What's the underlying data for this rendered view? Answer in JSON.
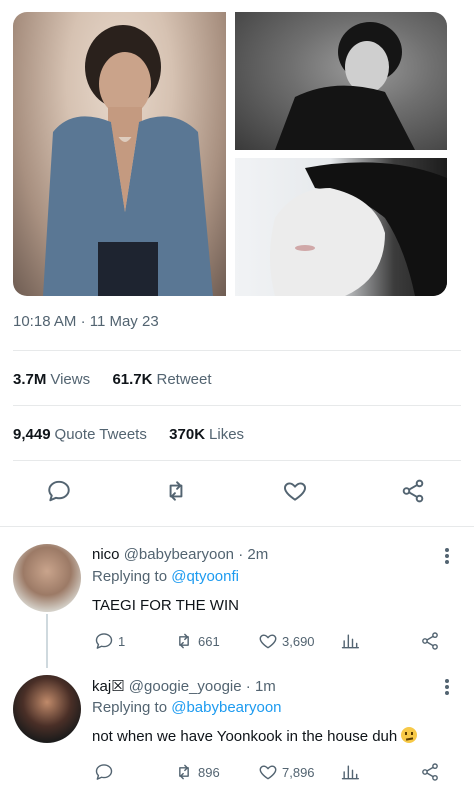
{
  "tweet": {
    "time": "10:18 AM",
    "separator": "·",
    "date": "11 May 23",
    "views_count": "3.7M",
    "views_label": "Views",
    "retweets_count": "61.7K",
    "retweets_label": "Retweet",
    "quotes_count": "9,449",
    "quotes_label": "Quote Tweets",
    "likes_count": "370K",
    "likes_label": "Likes"
  },
  "replies": [
    {
      "name": "nico",
      "handle": "@babybearyoon",
      "separator": "·",
      "age": "2m",
      "replying_prefix": "Replying to",
      "replying_to": "@qtyoonfi",
      "text": "TAEGI FOR THE WIN",
      "reply_count": "1",
      "retweet_count": "661",
      "like_count": "3,690"
    },
    {
      "name": "kaj☒",
      "handle": "@googie_yoogie",
      "separator": "·",
      "age": "1m",
      "replying_prefix": "Replying to",
      "replying_to": "@babybearyoon",
      "text": "not when we have Yoonkook in the house duh",
      "reply_count": "",
      "retweet_count": "896",
      "like_count": "7,896"
    }
  ],
  "icons": {
    "reply": "comment-icon",
    "retweet": "retweet-icon",
    "like": "heart-icon",
    "share": "share-icon",
    "analytics": "analytics-icon",
    "more": "more-icon"
  },
  "colors": {
    "text": "#0f1419",
    "muted": "#536471",
    "link": "#1d9bf0",
    "divider": "#e7e9ea"
  }
}
